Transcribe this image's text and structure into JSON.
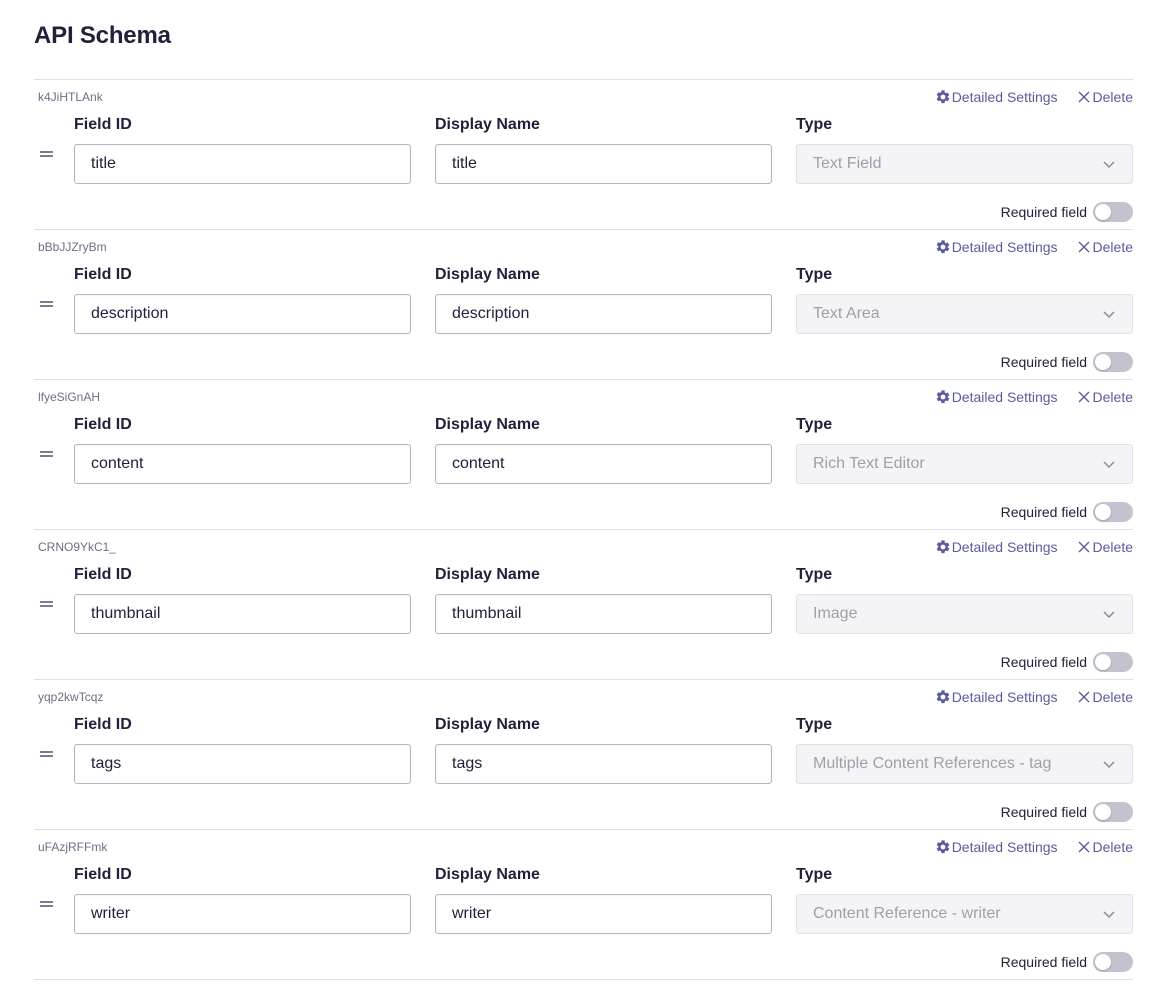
{
  "page": {
    "title": "API Schema"
  },
  "labels": {
    "field_id": "Field ID",
    "display_name": "Display Name",
    "type": "Type",
    "detailed_settings": "Detailed Settings",
    "delete": "Delete",
    "required_field": "Required field"
  },
  "icons": {
    "settings": "gear-icon",
    "delete": "close-icon",
    "drag": "drag-handle-icon",
    "select": "chevron-down-icon"
  },
  "colors": {
    "accent": "#5c5b9d",
    "toggle_off": "#c3c3cf",
    "text": "#21213b",
    "disabled_text": "#9f9fac"
  },
  "fields": [
    {
      "uid": "k4JiHTLAnk",
      "field_id": "title",
      "display_name": "title",
      "type": "Text Field",
      "required": false
    },
    {
      "uid": "bBbJJZryBm",
      "field_id": "description",
      "display_name": "description",
      "type": "Text Area",
      "required": false
    },
    {
      "uid": "lfyeSiGnAH",
      "field_id": "content",
      "display_name": "content",
      "type": "Rich Text Editor",
      "required": false
    },
    {
      "uid": "CRNO9YkC1_",
      "field_id": "thumbnail",
      "display_name": "thumbnail",
      "type": "Image",
      "required": false
    },
    {
      "uid": "yqp2kwTcqz",
      "field_id": "tags",
      "display_name": "tags",
      "type": "Multiple Content References - tag",
      "required": false
    },
    {
      "uid": "uFAzjRFFmk",
      "field_id": "writer",
      "display_name": "writer",
      "type": "Content Reference - writer",
      "required": false
    }
  ]
}
